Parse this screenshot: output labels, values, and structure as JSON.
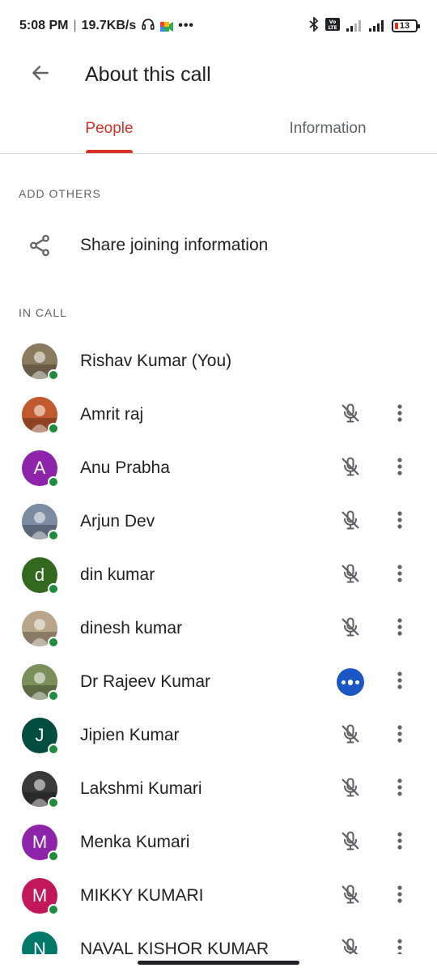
{
  "status_bar": {
    "time": "5:08 PM",
    "network_speed": "19.7KB/s",
    "more": "•••",
    "battery": "13"
  },
  "app_bar": {
    "title": "About this call"
  },
  "tabs": [
    {
      "label": "People",
      "active": true
    },
    {
      "label": "Information",
      "active": false
    }
  ],
  "add_others": {
    "header": "ADD OTHERS",
    "share_label": "Share joining information"
  },
  "in_call": {
    "header": "IN CALL",
    "people": [
      {
        "name": "Rishav Kumar (You)",
        "avatar_type": "photo",
        "avatar_color": "#8a7a5e",
        "initial": "",
        "mic": "none"
      },
      {
        "name": "Amrit raj",
        "avatar_type": "photo",
        "avatar_color": "#c05a2e",
        "initial": "",
        "mic": "muted"
      },
      {
        "name": "Anu Prabha",
        "avatar_type": "letter",
        "avatar_color": "#8e24aa",
        "initial": "A",
        "mic": "muted"
      },
      {
        "name": "Arjun Dev",
        "avatar_type": "photo",
        "avatar_color": "#7a8aa0",
        "initial": "",
        "mic": "muted"
      },
      {
        "name": "din kumar",
        "avatar_type": "letter",
        "avatar_color": "#33691e",
        "initial": "d",
        "mic": "muted"
      },
      {
        "name": "dinesh kumar",
        "avatar_type": "photo",
        "avatar_color": "#b8a58a",
        "initial": "",
        "mic": "muted"
      },
      {
        "name": "Dr Rajeev Kumar",
        "avatar_type": "photo",
        "avatar_color": "#7b8f5a",
        "initial": "",
        "mic": "speaking"
      },
      {
        "name": "Jipien Kumar",
        "avatar_type": "letter",
        "avatar_color": "#004d40",
        "initial": "J",
        "mic": "muted"
      },
      {
        "name": "Lakshmi Kumari",
        "avatar_type": "photo",
        "avatar_color": "#3a3a3a",
        "initial": "",
        "mic": "muted"
      },
      {
        "name": "Menka Kumari",
        "avatar_type": "letter",
        "avatar_color": "#8e24aa",
        "initial": "M",
        "mic": "muted"
      },
      {
        "name": "MIKKY KUMARI",
        "avatar_type": "letter",
        "avatar_color": "#c2185b",
        "initial": "M",
        "mic": "muted"
      },
      {
        "name": "NAVAL KISHOR KUMAR",
        "avatar_type": "letter",
        "avatar_color": "#00796b",
        "initial": "N",
        "mic": "muted"
      }
    ]
  },
  "colors": {
    "accent": "#d93025",
    "online": "#1e8e3e",
    "speaking": "#1a56c4"
  }
}
